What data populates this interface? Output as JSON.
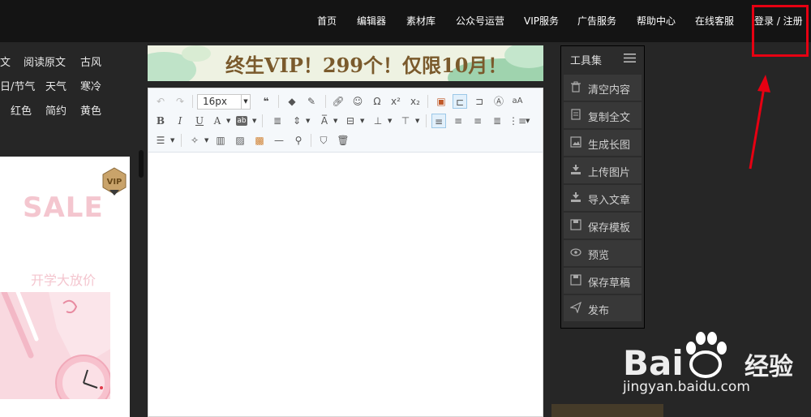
{
  "nav": {
    "items": [
      "首页",
      "编辑器",
      "素材库",
      "公众号运营",
      "VIP服务",
      "广告服务",
      "帮助中心",
      "在线客服"
    ],
    "login": "登录 / 注册"
  },
  "categories": {
    "row1": [
      "文",
      "阅读原文",
      "古风"
    ],
    "row2": [
      "日/节气",
      "天气",
      "寒冷"
    ],
    "row3": [
      "红色",
      "简约",
      "黄色"
    ]
  },
  "template": {
    "vip_badge": "VIP",
    "sale": "SALE",
    "subtitle": "开学大放价"
  },
  "banner": {
    "text": "终生VIP！299个！仅限10月！"
  },
  "editor": {
    "font_size": "16px"
  },
  "tools": {
    "title": "工具集",
    "items": [
      {
        "label": "清空内容",
        "icon": "trash-icon"
      },
      {
        "label": "复制全文",
        "icon": "copy-icon"
      },
      {
        "label": "生成长图",
        "icon": "image-icon"
      },
      {
        "label": "上传图片",
        "icon": "upload-icon"
      },
      {
        "label": "导入文章",
        "icon": "import-icon"
      },
      {
        "label": "保存模板",
        "icon": "save-icon"
      },
      {
        "label": "预览",
        "icon": "eye-icon"
      },
      {
        "label": "保存草稿",
        "icon": "save-icon"
      },
      {
        "label": "发布",
        "icon": "send-icon"
      }
    ]
  },
  "watermark": {
    "bai": "Bai",
    "du": "经验",
    "url": "jingyan.baidu.com"
  },
  "colors": {
    "highlight_red": "#e60012",
    "background": "#262626",
    "pink": "#f4c6cf"
  }
}
